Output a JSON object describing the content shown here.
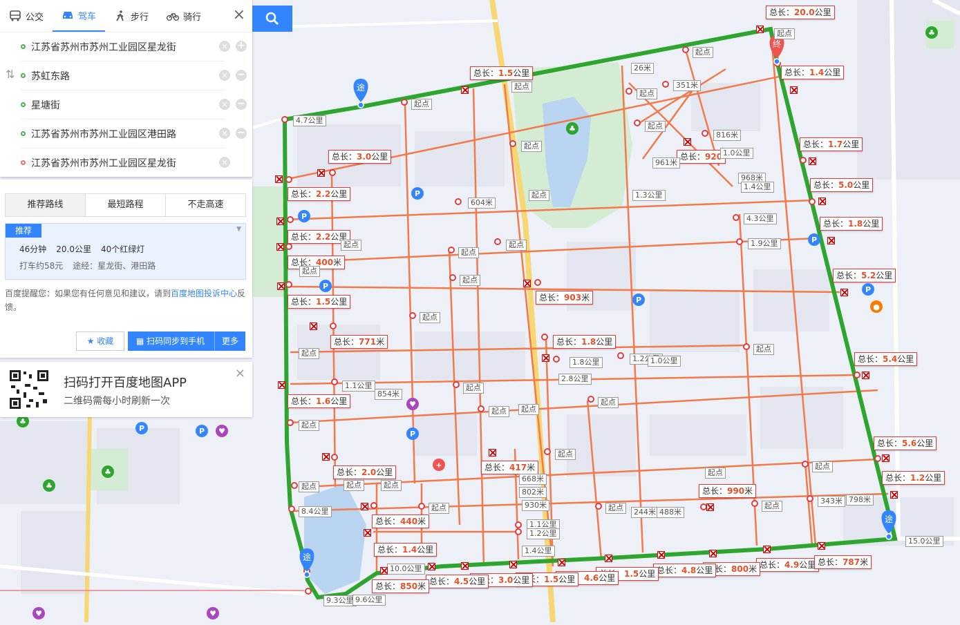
{
  "modes": [
    {
      "label": "公交",
      "icon": "bus-icon"
    },
    {
      "label": "驾车",
      "icon": "car-icon"
    },
    {
      "label": "步行",
      "icon": "walk-icon"
    },
    {
      "label": "骑行",
      "icon": "bike-icon"
    }
  ],
  "waypoints": [
    "江苏省苏州市苏州工业园区星龙街",
    "苏虹东路",
    "星塘街",
    "江苏省苏州市苏州工业园区港田路",
    "江苏省苏州市苏州工业园区星龙街"
  ],
  "route_tabs": [
    "推荐路线",
    "最短路程",
    "不走高速"
  ],
  "plan": {
    "badge": "推荐",
    "time": "46分钟",
    "distance": "20.0公里",
    "lights": "40个红绿灯",
    "taxi": "打车约58元",
    "via": "途经：星龙街、港田路"
  },
  "tip": {
    "prefix": "百度提醒您：如果您有任何意见和建议，请到",
    "link": "百度地图投诉中心",
    "suffix": "反馈。"
  },
  "buttons": {
    "favorite": "收藏",
    "sync": "扫码同步到手机",
    "more": "更多"
  },
  "qr": {
    "title": "扫码打开百度地图APP",
    "subtitle": "二维码需每小时刷新一次"
  },
  "map_labels": {
    "start_word": "起点",
    "total_prefix": "总长：",
    "total_values": [
      "20.0公里",
      "1.5公里",
      "1.4公里",
      "3.0公里",
      "1.7公里",
      "5.0公里",
      "2.2公里",
      "1.8公里",
      "2.2公里",
      "400米",
      "5.2公里",
      "1.5公里",
      "903米",
      "771米",
      "1.8公里",
      "5.4公里",
      "1.6公里",
      "5.6公里",
      "2.0公里",
      "417米",
      "1.2公里",
      "990米",
      "440米",
      "1.4公里",
      "4.9公里",
      "787米",
      "800米",
      "4.8公里",
      "1.5公里",
      "4.6公里",
      "1.5公里",
      "3.0公里",
      "4.5公里",
      "850米",
      "920"
    ],
    "grey_values": [
      "4.7公里",
      "26米",
      "351米",
      "816米",
      "1.0公里",
      "961米",
      "968米",
      "1.4公里",
      "1.3公里",
      "604米",
      "4.3公里",
      "1.9公里",
      "1.8公里",
      "1.2公里",
      "1.0公里",
      "2.8公里",
      "1.1公里",
      "854米",
      "668米",
      "802米",
      "930米",
      "1.1公里",
      "1.2公里",
      "1.4公里",
      "244米",
      "488米",
      "343米",
      "798米",
      "15.0公里",
      "8.4公里",
      "10.0公里",
      "9.3公里",
      "9.6公里"
    ]
  },
  "markers": {
    "via": "途",
    "end": "终"
  },
  "colors": {
    "route_green": "#2ea52e",
    "route_orange": "#f2794a",
    "accent": "#3385ff",
    "label_red": "#e23b3b"
  }
}
